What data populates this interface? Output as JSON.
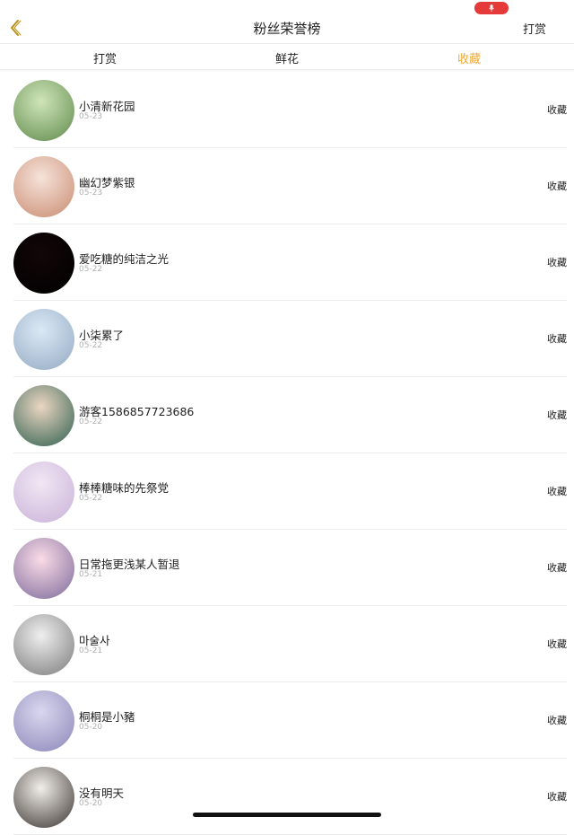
{
  "navbar": {
    "title": "粉丝荣誉榜",
    "right_label": "打赏",
    "back_icon": "chevron-left-icon",
    "accent_color": "#b8921a"
  },
  "status": {
    "mic_icon": "microphone-icon",
    "mic_color": "#e43a3a"
  },
  "tabs": [
    {
      "label": "打赏",
      "active": false
    },
    {
      "label": "鲜花",
      "active": false
    },
    {
      "label": "收藏",
      "active": true
    }
  ],
  "tab_active_color": "#f1a833",
  "fans": [
    {
      "name": "小清新花园",
      "date": "05-23",
      "action": "收藏",
      "avatar_colors": [
        "#cfe5b9",
        "#5f8a4b"
      ]
    },
    {
      "name": "幽幻梦紫银",
      "date": "05-23",
      "action": "收藏",
      "avatar_colors": [
        "#f6e3da",
        "#c98b70"
      ]
    },
    {
      "name": "爱吃糖的纯洁之光",
      "date": "05-22",
      "action": "收藏",
      "avatar_colors": [
        "#120608",
        "#000000"
      ]
    },
    {
      "name": "小柒累了",
      "date": "05-22",
      "action": "收藏",
      "avatar_colors": [
        "#dbe9f6",
        "#93a9c2"
      ]
    },
    {
      "name": "游客1586857723686",
      "date": "05-22",
      "action": "收藏",
      "avatar_colors": [
        "#ead6c2",
        "#2e5e4e"
      ]
    },
    {
      "name": "棒棒糖味的先祭党",
      "date": "05-22",
      "action": "收藏",
      "avatar_colors": [
        "#f1e7f4",
        "#c9b1d8"
      ]
    },
    {
      "name": "日常拖更浅某人暂退",
      "date": "05-21",
      "action": "收藏",
      "avatar_colors": [
        "#fadbe7",
        "#7c6a9a"
      ]
    },
    {
      "name": "마술사",
      "date": "05-21",
      "action": "收藏",
      "avatar_colors": [
        "#efefef",
        "#7a7a7a"
      ]
    },
    {
      "name": "桐桐是小豬",
      "date": "05-20",
      "action": "收藏",
      "avatar_colors": [
        "#d9d7ef",
        "#8c86b8"
      ]
    },
    {
      "name": "没有明天",
      "date": "05-20",
      "action": "收藏",
      "avatar_colors": [
        "#f2eee9",
        "#3a3431"
      ]
    }
  ]
}
